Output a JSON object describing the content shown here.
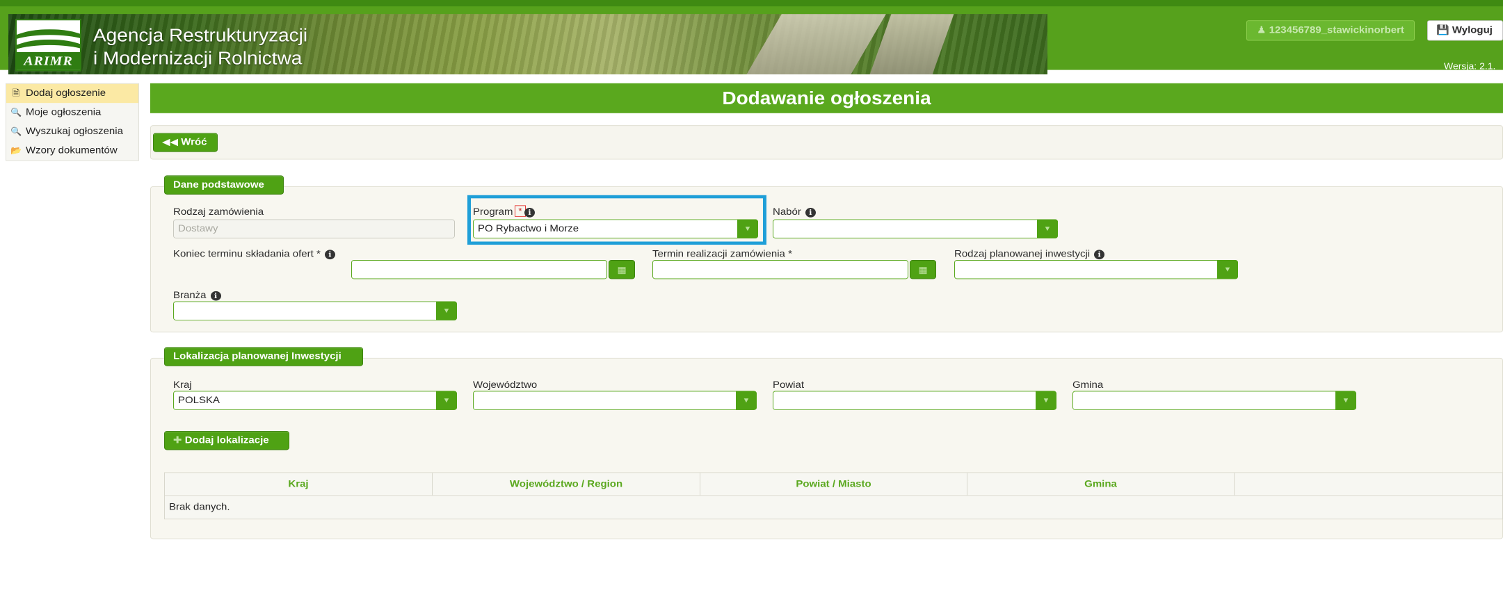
{
  "header": {
    "logo_text": "ARIMR",
    "agency_line1": "Agencja Restrukturyzacji",
    "agency_line2": "i Modernizacji Rolnictwa",
    "user": "123456789_stawickinorbert",
    "logout": "Wyloguj",
    "version": "Wersja: 2.1."
  },
  "sidebar": {
    "items": [
      {
        "label": "Dodaj ogłoszenie",
        "icon": "document-icon",
        "active": true
      },
      {
        "label": "Moje ogłoszenia",
        "icon": "search-icon",
        "active": false
      },
      {
        "label": "Wyszukaj ogłoszenia",
        "icon": "search-icon",
        "active": false
      },
      {
        "label": "Wzory dokumentów",
        "icon": "folder-open-icon",
        "active": false
      }
    ]
  },
  "page": {
    "title": "Dodawanie ogłoszenia",
    "back": "Wróć"
  },
  "basic": {
    "section_label": "Dane podstawowe",
    "rodzaj_label": "Rodzaj zamówienia",
    "rodzaj_value": "Dostawy",
    "program_label": "Program",
    "program_value": "PO Rybactwo i Morze",
    "nabor_label": "Nabór",
    "nabor_value": "",
    "koniec_label": "Koniec terminu składania ofert *",
    "koniec_value": "",
    "termin_label": "Termin realizacji zamówienia *",
    "termin_value": "",
    "rodzaj_inwest_label": "Rodzaj planowanej inwestycji",
    "rodzaj_inwest_value": "",
    "branza_label": "Branża",
    "branza_value": ""
  },
  "location": {
    "section_label": "Lokalizacja planowanej Inwestycji",
    "kraj_label": "Kraj",
    "kraj_value": "POLSKA",
    "woj_label": "Województwo",
    "woj_value": "",
    "powiat_label": "Powiat",
    "powiat_value": "",
    "gmina_label": "Gmina",
    "gmina_value": "",
    "add_button": "Dodaj lokalizacje"
  },
  "table": {
    "columns": [
      "Kraj",
      "Województwo / Region",
      "Powiat / Miasto",
      "Gmina",
      ""
    ],
    "empty_text": "Brak danych."
  },
  "colors": {
    "brand_green": "#5aa81e",
    "highlight_blue": "#1f9fd8",
    "active_item": "#fbe9a4"
  }
}
